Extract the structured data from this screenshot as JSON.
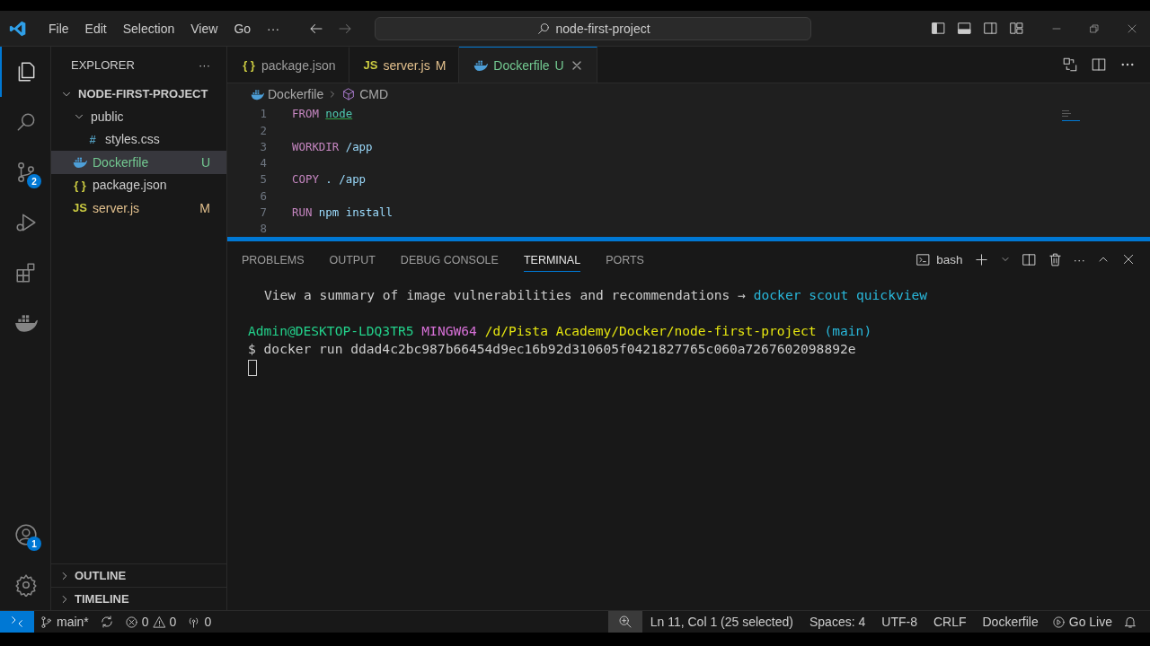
{
  "title_bar": {
    "menu": [
      "File",
      "Edit",
      "Selection",
      "View",
      "Go"
    ],
    "more": "···",
    "search": "node-first-project"
  },
  "activity_bar": {
    "items": [
      {
        "kind": "explorer",
        "selected": true
      },
      {
        "kind": "search",
        "selected": false
      },
      {
        "kind": "source-control",
        "selected": false,
        "badge": "2"
      },
      {
        "kind": "run",
        "selected": false
      },
      {
        "kind": "extensions",
        "selected": false
      },
      {
        "kind": "docker",
        "selected": false
      }
    ],
    "bottom": [
      {
        "kind": "accounts",
        "badge": "1"
      },
      {
        "kind": "settings"
      }
    ]
  },
  "sidebar": {
    "title": "EXPLORER",
    "more": "···",
    "tree": [
      {
        "label": "NODE-FIRST-PROJECT",
        "kind": "root",
        "expanded": true,
        "selected": false,
        "children": [
          {
            "label": "public",
            "kind": "folder",
            "expanded": true,
            "selected": false,
            "children": [
              {
                "label": "styles.css",
                "kind": "css",
                "icon": "#",
                "selected": false
              }
            ]
          },
          {
            "label": "Dockerfile",
            "kind": "docker",
            "status": "U",
            "selected": true
          },
          {
            "label": "package.json",
            "kind": "json",
            "icon": "{ }",
            "selected": false
          },
          {
            "label": "server.js",
            "kind": "js",
            "icon": "JS",
            "status": "M",
            "selected": false
          }
        ]
      }
    ],
    "sections": [
      {
        "label": "OUTLINE",
        "expanded": false
      },
      {
        "label": "TIMELINE",
        "expanded": false
      }
    ]
  },
  "editor": {
    "tabs": [
      {
        "label": "package.json",
        "kind": "json",
        "icon": "{ }",
        "selected": false
      },
      {
        "label": "server.js",
        "kind": "js",
        "icon": "JS",
        "status": "M",
        "selected": false
      },
      {
        "label": "Dockerfile",
        "kind": "docker",
        "status": "U",
        "selected": true
      }
    ],
    "breadcrumb": [
      "Dockerfile",
      "CMD"
    ],
    "lines": [
      {
        "number": "1",
        "tokens": [
          {
            "text": "FROM",
            "kind": "keyword"
          },
          {
            "text": "node",
            "kind": "image"
          }
        ]
      },
      {
        "number": "2"
      },
      {
        "number": "3",
        "tokens": [
          {
            "text": "WORKDIR",
            "kind": "keyword"
          },
          {
            "text": "/app",
            "kind": "arg"
          }
        ]
      },
      {
        "number": "4"
      },
      {
        "number": "5",
        "tokens": [
          {
            "text": "COPY",
            "kind": "keyword"
          },
          {
            "text": ". /app",
            "kind": "arg"
          }
        ]
      },
      {
        "number": "6"
      },
      {
        "number": "7",
        "tokens": [
          {
            "text": "RUN",
            "kind": "keyword"
          },
          {
            "text": "npm install",
            "kind": "arg"
          }
        ]
      },
      {
        "number": "8"
      }
    ]
  },
  "panel": {
    "tabs": [
      {
        "label": "PROBLEMS",
        "selected": false
      },
      {
        "label": "OUTPUT",
        "selected": false
      },
      {
        "label": "DEBUG CONSOLE",
        "selected": false
      },
      {
        "label": "TERMINAL",
        "selected": true
      },
      {
        "label": "PORTS",
        "selected": false
      }
    ],
    "shell": "bash",
    "more": "···",
    "terminal": [
      {
        "kind": "notice",
        "tokens": [
          {
            "text": "View a summary of image vulnerabilities and recommendations →",
            "kind": "plain"
          },
          {
            "text": "docker scout quickview",
            "kind": "link"
          }
        ]
      },
      {
        "kind": "prompt",
        "tokens": [
          {
            "text": "Admin@DESKTOP-LDQ3TR5",
            "kind": "user"
          },
          {
            "text": "MINGW64",
            "kind": "host"
          },
          {
            "text": "/d/Pista Academy/Docker/node-first-project",
            "kind": "path"
          },
          {
            "text": "(main)",
            "kind": "branch"
          }
        ]
      },
      {
        "kind": "command",
        "tokens": [
          {
            "text": "$ docker run ddad4c2bc987b66454d9ec16b92d310605f0421827765c060a7267602098892e",
            "kind": "plain"
          }
        ]
      }
    ],
    "cursor": true
  },
  "status_bar": {
    "left": [
      {
        "kind": "remote"
      },
      {
        "kind": "branch",
        "text": "main*"
      },
      {
        "kind": "sync"
      },
      {
        "kind": "problems",
        "errors": "0",
        "warnings": "0"
      },
      {
        "kind": "ports",
        "text": "0"
      }
    ],
    "right": [
      {
        "kind": "zoom"
      },
      {
        "kind": "text",
        "text": "Ln 11, Col 1 (25 selected)"
      },
      {
        "kind": "text",
        "text": "Spaces: 4"
      },
      {
        "kind": "text",
        "text": "UTF-8"
      },
      {
        "kind": "text",
        "text": "CRLF"
      },
      {
        "kind": "text",
        "text": "Dockerfile"
      },
      {
        "kind": "golive",
        "text": "Go Live"
      },
      {
        "kind": "bell"
      }
    ]
  }
}
